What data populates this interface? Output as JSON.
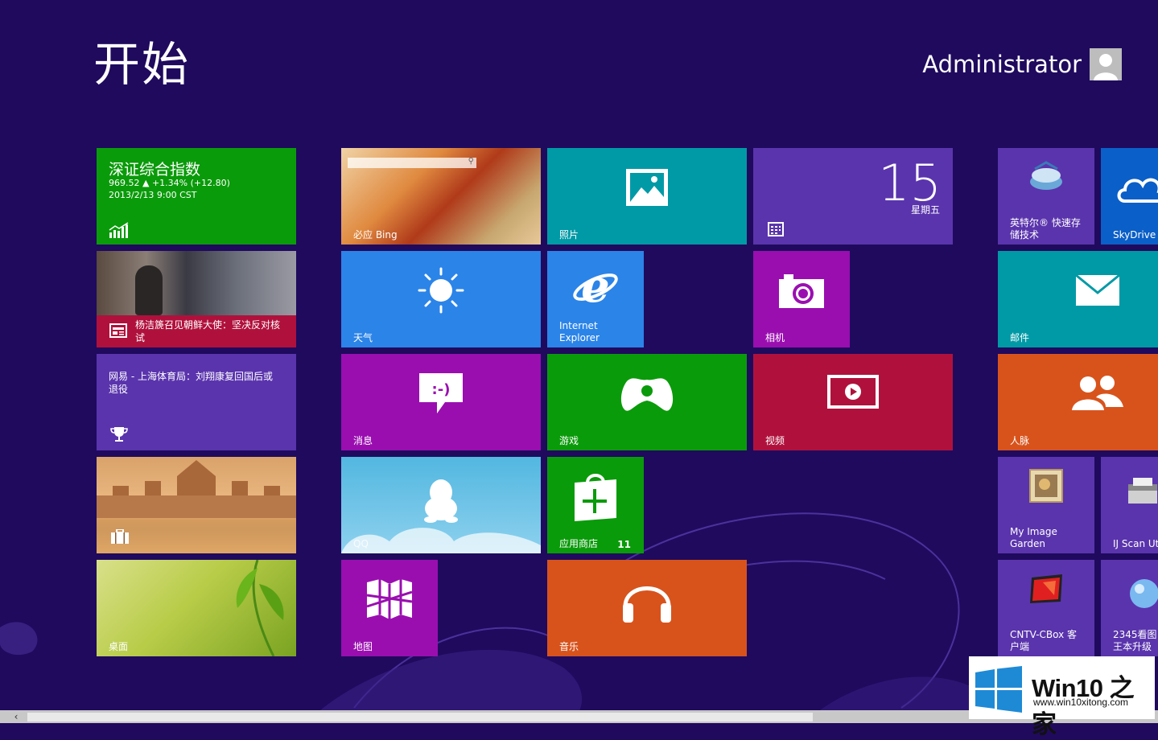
{
  "title": "开始",
  "user": {
    "name": "Administrator"
  },
  "tiles": {
    "finance": {
      "title": "深证综合指数",
      "line1": "969.52  ▲ +1.34% (+12.80)",
      "line2": "2013/2/13 9:00 CST"
    },
    "news": {
      "headline": "杨洁篪召见朝鲜大使：坚决反对核试"
    },
    "sports": {
      "headline": "网易 - 上海体育局：刘翔康复回国后或退役"
    },
    "travel": {},
    "desktop": {
      "label": "桌面"
    },
    "bing": {
      "label": "必应 Bing"
    },
    "weather": {
      "label": "天气"
    },
    "messaging": {
      "label": "消息"
    },
    "qq": {
      "label": "QQ"
    },
    "maps": {
      "label": "地图"
    },
    "photos": {
      "label": "照片"
    },
    "ie": {
      "label": "Internet Explorer"
    },
    "games": {
      "label": "游戏"
    },
    "store": {
      "label": "应用商店",
      "badge": "11"
    },
    "music": {
      "label": "音乐"
    },
    "calendar": {
      "day": "15",
      "weekday": "星期五"
    },
    "camera": {
      "label": "相机"
    },
    "video": {
      "label": "视频"
    },
    "intel": {
      "label": "英特尔® 快速存储技术"
    },
    "skydrive": {
      "label": "SkyDrive"
    },
    "mail": {
      "label": "邮件"
    },
    "people": {
      "label": "人脉"
    },
    "myimage": {
      "label": "My Image Garden"
    },
    "ijscan": {
      "label": "IJ Scan Ut"
    },
    "cntv": {
      "label": "CNTV-CBox 客户端"
    },
    "viewer2345": {
      "label": "2345看图王本升级"
    }
  },
  "watermark": {
    "text": "Win10 之家",
    "url": "www.win10xitong.com"
  },
  "colors": {
    "background": "#1f0a5e"
  }
}
